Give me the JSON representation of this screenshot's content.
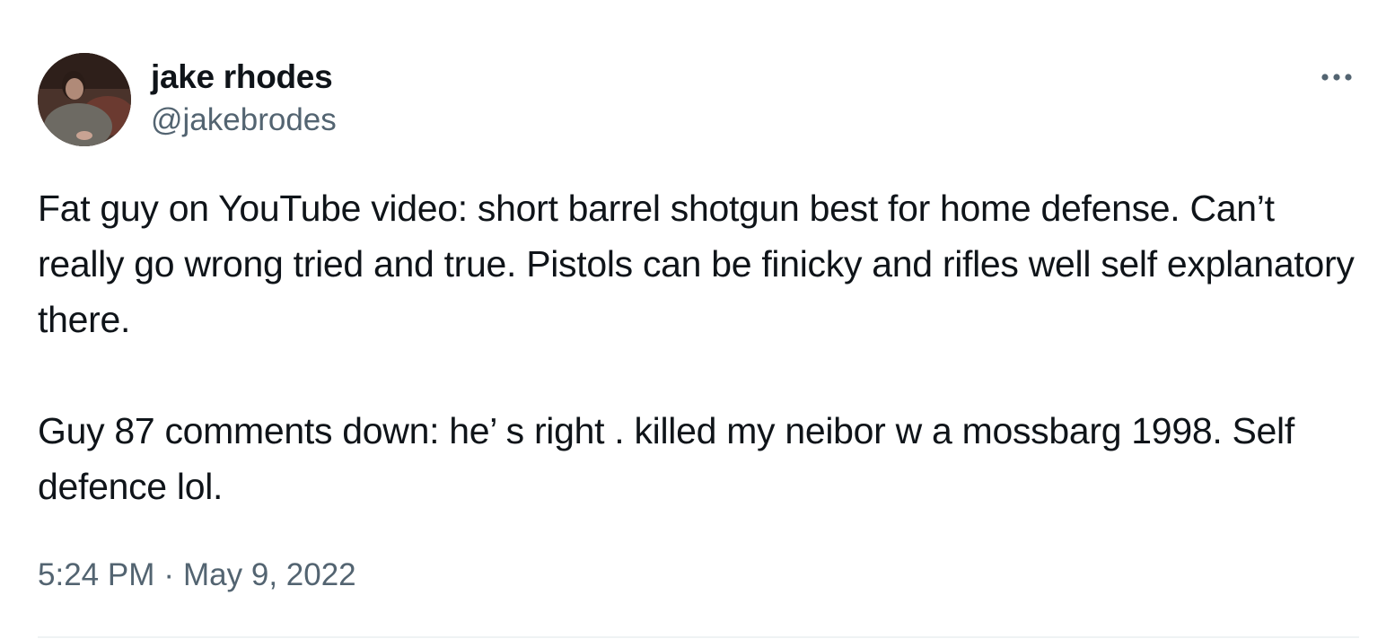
{
  "author": {
    "display_name": "jake rhodes",
    "handle": "@jakebrodes"
  },
  "tweet": {
    "paragraphs": [
      "Fat guy on YouTube video: short barrel shotgun best for home defense. Can’t really go wrong tried and true. Pistols can be finicky and rifles well self explanatory there.",
      "Guy 87 comments down: he’ s right . killed my neibor w a mossbarg 1998. Self defence lol."
    ],
    "time": "5:24 PM",
    "separator": "·",
    "date": "May 9, 2022"
  },
  "icons": {
    "more": "more-horizontal-icon"
  },
  "colors": {
    "text_primary": "#0f1419",
    "text_secondary": "#536471",
    "divider": "#eff3f4"
  }
}
